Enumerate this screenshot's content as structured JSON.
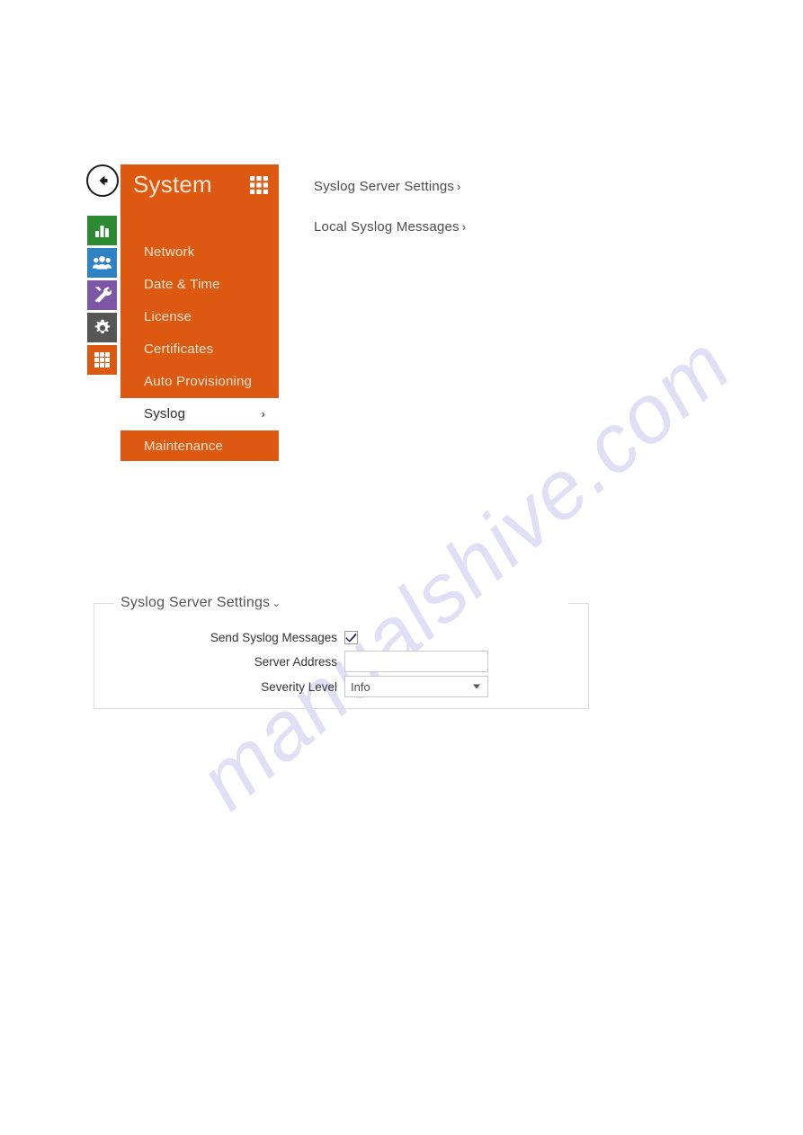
{
  "watermark": {
    "text": "manualshive.com",
    "color": "#cfcdf0"
  },
  "theme": {
    "orange": "#dd5810",
    "cream_text": "#fbe6d2",
    "icon_green": "#2d8a32",
    "icon_blue": "#2f82c4",
    "icon_purple": "#7d56a8",
    "icon_gray": "#565656",
    "icon_orange": "#dd5810"
  },
  "menu_panel": {
    "title": "System",
    "back_icon": "back-arrow-icon",
    "grid_icon": "grid-icon",
    "rail_icons": [
      {
        "name": "bar-chart-icon",
        "color": "#2d8a32"
      },
      {
        "name": "users-icon",
        "color": "#2f82c4"
      },
      {
        "name": "tools-icon",
        "color": "#7d56a8"
      },
      {
        "name": "gear-icon",
        "color": "#565656"
      },
      {
        "name": "grid-icon",
        "color": "#dd5810"
      }
    ],
    "items": [
      {
        "label": "Network",
        "active": false,
        "chevron": ""
      },
      {
        "label": "Date & Time",
        "active": false,
        "chevron": ""
      },
      {
        "label": "License",
        "active": false,
        "chevron": ""
      },
      {
        "label": "Certificates",
        "active": false,
        "chevron": ""
      },
      {
        "label": "Auto Provisioning",
        "active": false,
        "chevron": ""
      },
      {
        "label": "Syslog",
        "active": true,
        "chevron": "›"
      },
      {
        "label": "Maintenance",
        "active": false,
        "chevron": ""
      }
    ]
  },
  "section_links": [
    {
      "label": "Syslog Server Settings",
      "arrow": "›"
    },
    {
      "label": "Local Syslog Messages",
      "arrow": "›"
    }
  ],
  "form": {
    "legend": "Syslog Server Settings",
    "legend_chevron": "⌄",
    "rows": [
      {
        "label": "Send Syslog Messages",
        "type": "checkbox",
        "checked": true
      },
      {
        "label": "Server Address",
        "type": "text",
        "value": "",
        "placeholder": ""
      },
      {
        "label": "Severity Level",
        "type": "select",
        "value": "Info"
      }
    ]
  }
}
